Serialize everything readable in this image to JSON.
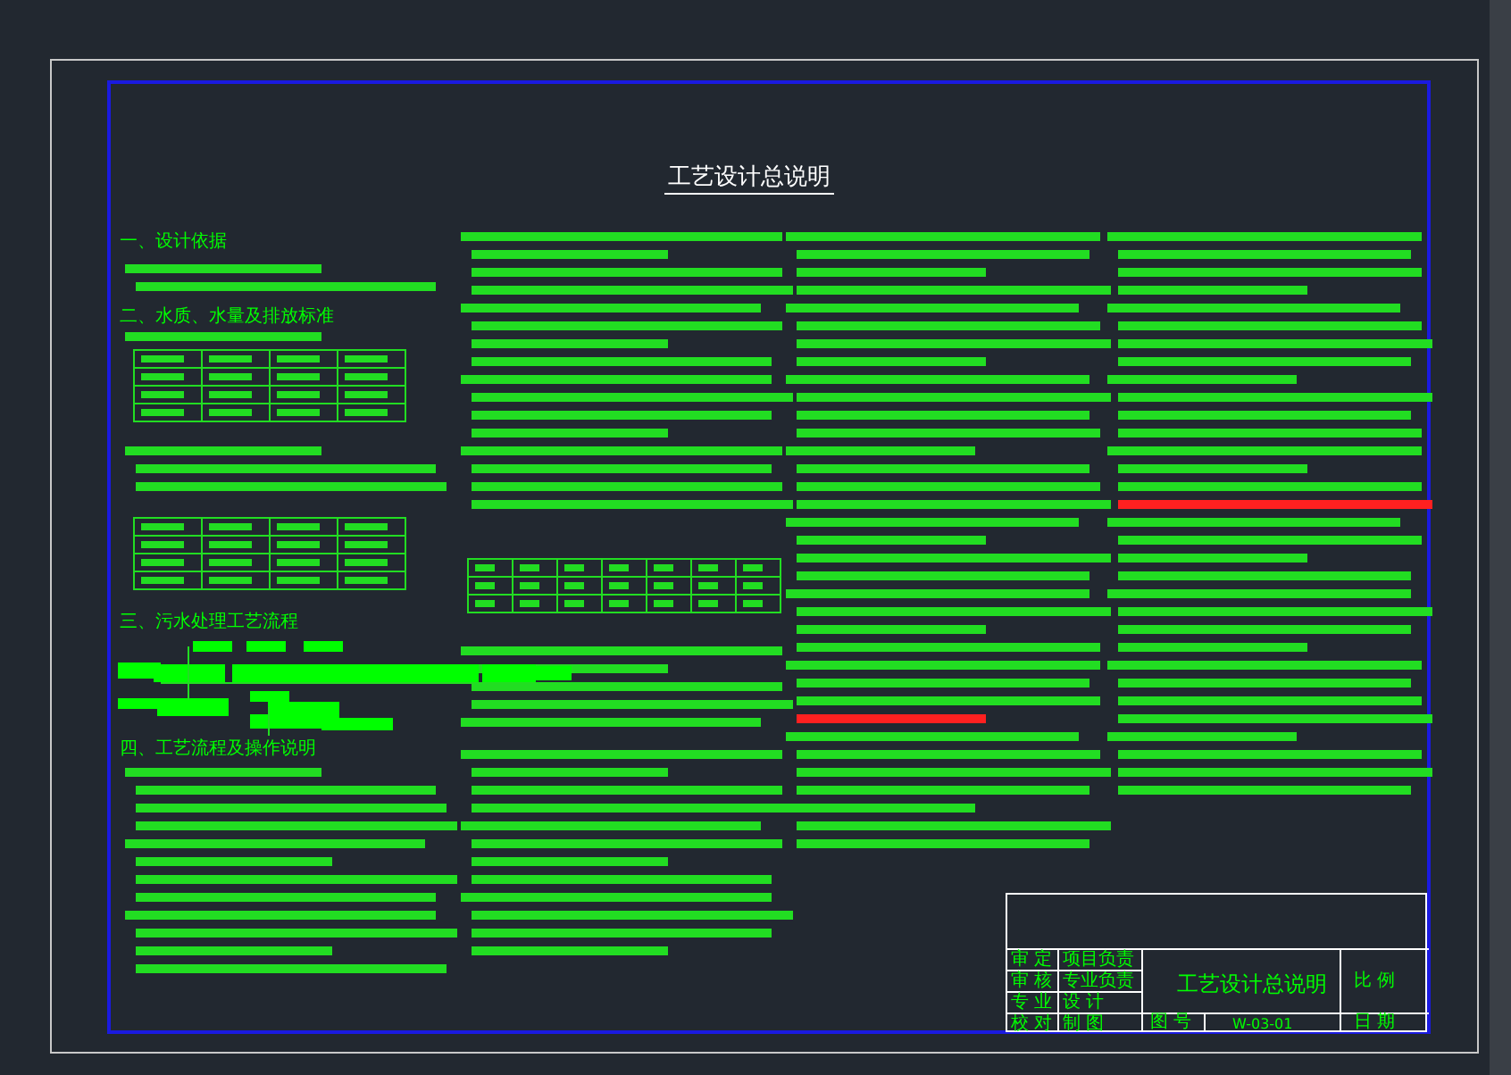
{
  "drawing": {
    "title": "工艺设计总说明",
    "headings": [
      {
        "text": "一、设计依据"
      },
      {
        "text": "二、水质、水量及排放标准"
      },
      {
        "text": "三、污水处理工艺流程"
      },
      {
        "text": "四、工艺流程及操作说明"
      }
    ],
    "title_block": {
      "left": [
        "审 定",
        "审 核",
        "专 业",
        "校 对"
      ],
      "middle": [
        "项目负责",
        "专业负责",
        "设 计",
        "制 图"
      ],
      "drawing_title": "工艺设计总说明",
      "drawing_no_label": "图 号",
      "drawing_no": "W-03-01",
      "right": [
        "比 例",
        "日 期"
      ]
    }
  }
}
